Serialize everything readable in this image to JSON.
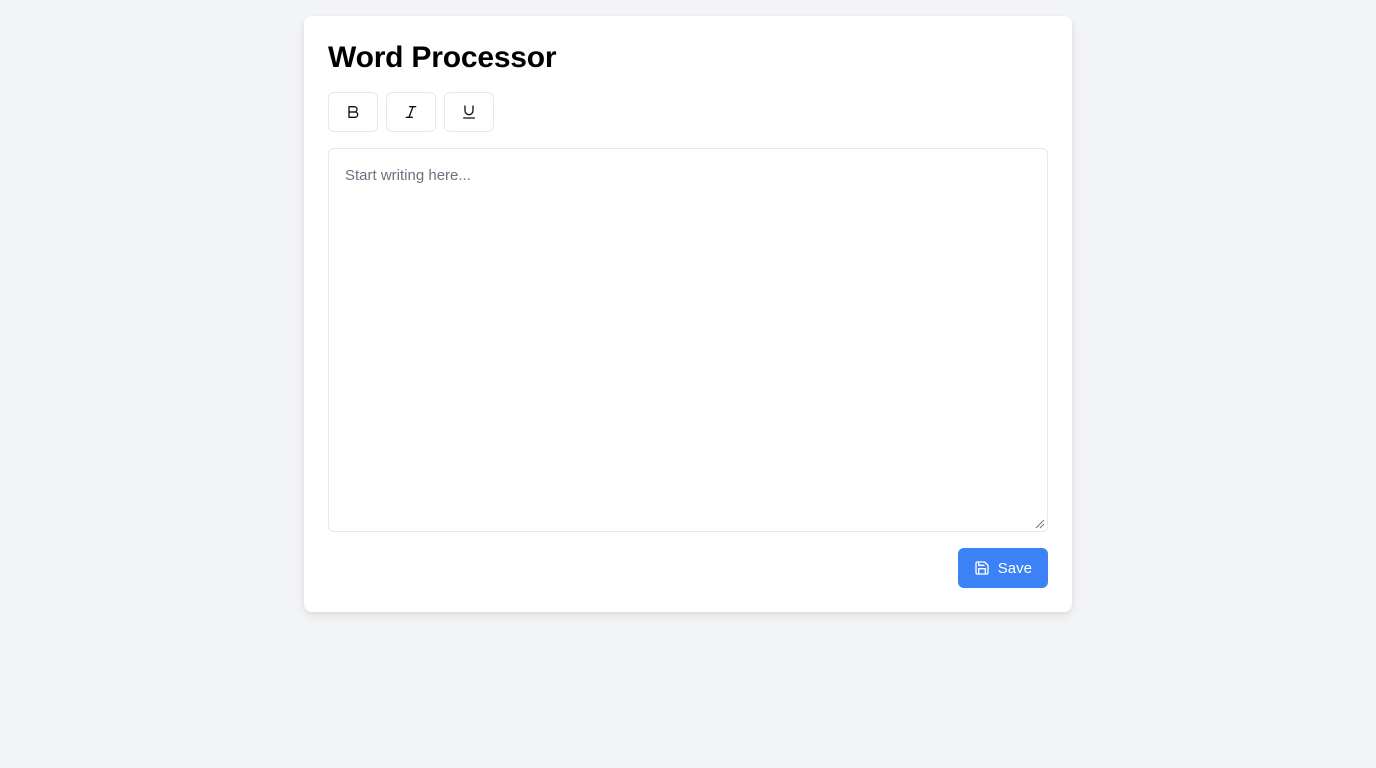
{
  "app": {
    "title": "Word Processor"
  },
  "toolbar": {
    "buttons": [
      {
        "icon": "bold-icon",
        "glyph": "B"
      },
      {
        "icon": "italic-icon",
        "glyph": "I"
      },
      {
        "icon": "underline-icon",
        "glyph": "U"
      }
    ]
  },
  "editor": {
    "value": "",
    "placeholder": "Start writing here..."
  },
  "actions": {
    "save_label": "Save",
    "save_icon": "save-icon"
  },
  "colors": {
    "background": "#f3f4f6",
    "card": "#ffffff",
    "accent": "#3b82f6",
    "border": "#e5e7eb",
    "placeholder": "#6b7280"
  }
}
